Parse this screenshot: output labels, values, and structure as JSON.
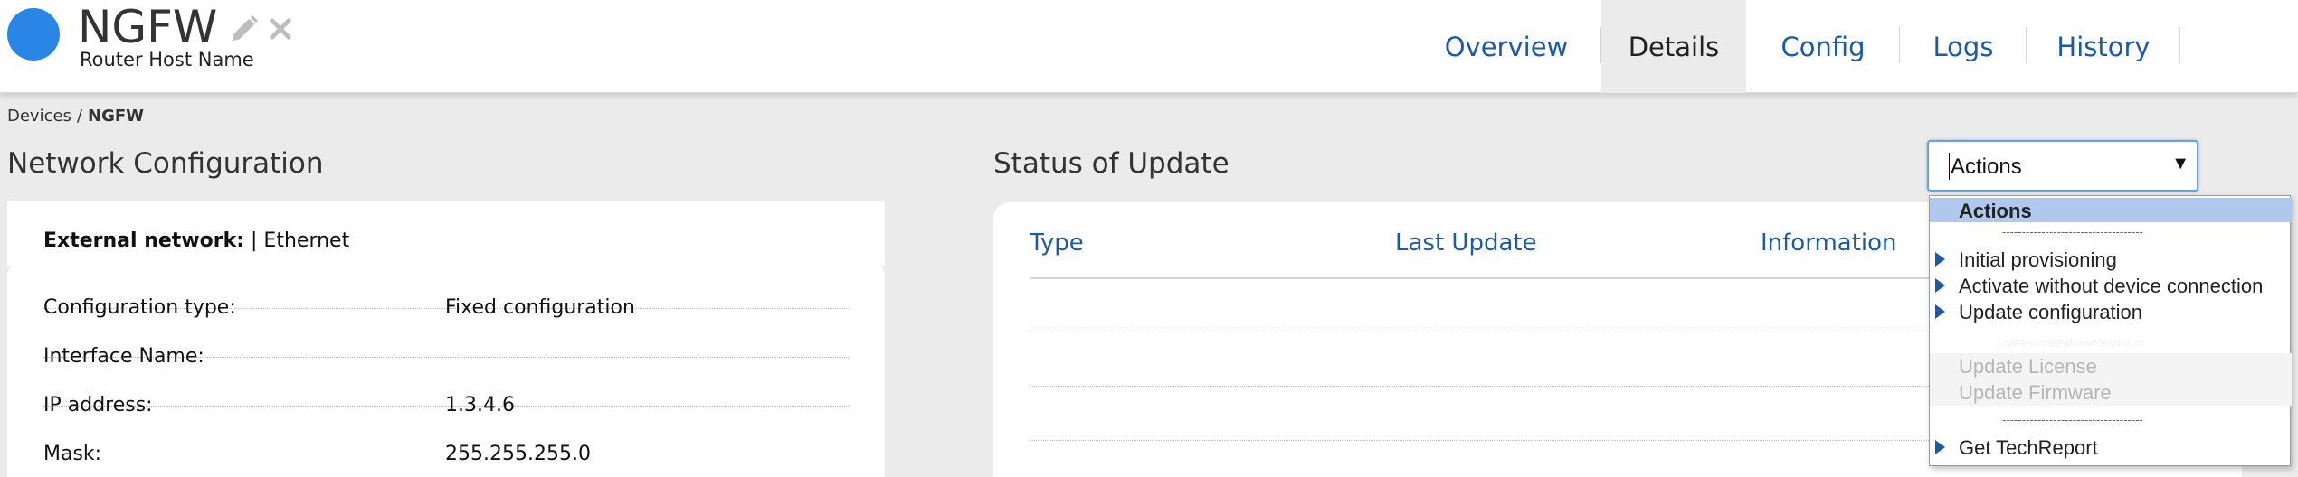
{
  "header": {
    "device_name": "NGFW",
    "host_name": "Router Host Name",
    "status_color": "#2a86e6",
    "tabs": [
      {
        "label": "Overview",
        "active": false
      },
      {
        "label": "Details",
        "active": true
      },
      {
        "label": "Config",
        "active": false
      },
      {
        "label": "Logs",
        "active": false
      },
      {
        "label": "History",
        "active": false
      }
    ]
  },
  "breadcrumb": {
    "parent": "Devices",
    "separator": "/",
    "current": "NGFW"
  },
  "network": {
    "title": "Network Configuration",
    "external_label": "External network:",
    "external_value": "| Ethernet",
    "rows": [
      {
        "key": "Configuration type:",
        "value": "Fixed configuration"
      },
      {
        "key": "Interface Name:",
        "value": ""
      },
      {
        "key": "IP address:",
        "value": "1.3.4.6"
      },
      {
        "key": "Mask:",
        "value": "255.255.255.0"
      }
    ]
  },
  "status": {
    "title": "Status of Update",
    "columns": [
      "Type",
      "Last Update",
      "Information"
    ]
  },
  "actions": {
    "selected": "Actions",
    "options": [
      {
        "label": "Actions",
        "kind": "header"
      },
      {
        "label": "------------------------------------",
        "kind": "separator"
      },
      {
        "label": "Initial provisioning",
        "kind": "enabled"
      },
      {
        "label": "Activate without device connection",
        "kind": "enabled"
      },
      {
        "label": "Update configuration",
        "kind": "enabled"
      },
      {
        "label": "------------------------------------",
        "kind": "separator"
      },
      {
        "label": "Update License",
        "kind": "disabled"
      },
      {
        "label": "Update Firmware",
        "kind": "disabled"
      },
      {
        "label": "------------------------------------",
        "kind": "separator"
      },
      {
        "label": "Get TechReport",
        "kind": "enabled"
      }
    ]
  },
  "colors": {
    "accent": "#1c5aa6",
    "status_dot": "#2a86e6",
    "dropdown_highlight": "#b0c8ee"
  }
}
